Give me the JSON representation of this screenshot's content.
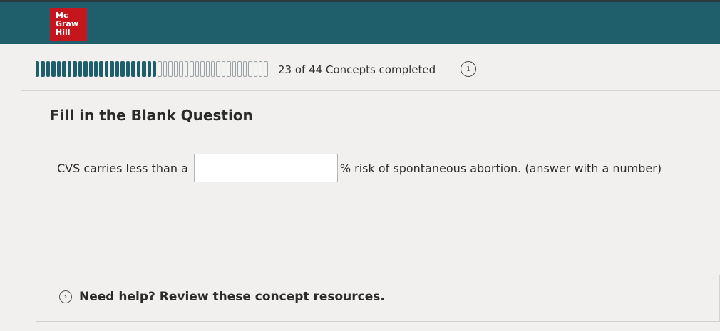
{
  "brand": {
    "logo_lines": [
      "Mc",
      "Graw",
      "Hill"
    ]
  },
  "progress": {
    "completed": 23,
    "total": 44,
    "label": "23 of 44 Concepts completed",
    "fill_color": "#1f5f6c"
  },
  "question": {
    "title": "Fill in the Blank Question",
    "text_before": "CVS carries less than a",
    "answer_value": "",
    "text_after": "% risk of spontaneous abortion. (answer with a number)"
  },
  "help": {
    "label": "Need help? Review these concept resources."
  },
  "icons": {
    "info": "info-icon",
    "expand": "chevron-right-icon"
  },
  "colors": {
    "header": "#1f5f6c",
    "logo": "#c4161c"
  }
}
